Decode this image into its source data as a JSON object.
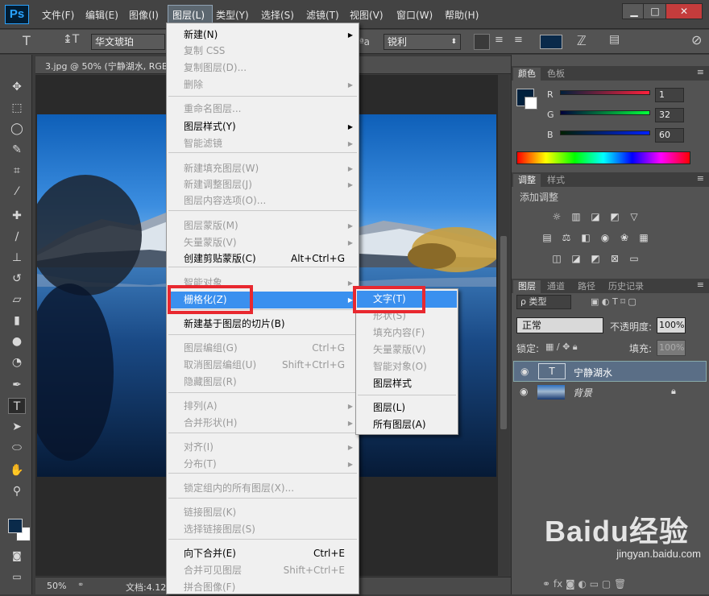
{
  "app": {
    "logo": "Ps"
  },
  "menubar": {
    "items": [
      "文件(F)",
      "编辑(E)",
      "图像(I)",
      "图层(L)",
      "类型(Y)",
      "选择(S)",
      "滤镜(T)",
      "视图(V)",
      "窗口(W)",
      "帮助(H)"
    ],
    "window_buttons": [
      "▁",
      "□",
      "✕"
    ]
  },
  "options": {
    "font_family": "华文琥珀",
    "aa_label": "ªa",
    "aa_value": "锐利",
    "color": "#0a2a4a"
  },
  "document": {
    "tab_title": "3.jpg @ 50% (宁静湖水, RGB",
    "zoom": "50%",
    "doc_info": "文档:4.12"
  },
  "layer_menu": {
    "items": [
      {
        "label": "新建(N)",
        "disabled": false,
        "submenu": true
      },
      {
        "label": "复制 CSS",
        "disabled": true
      },
      {
        "label": "复制图层(D)...",
        "disabled": true
      },
      {
        "label": "删除",
        "disabled": true,
        "submenu": true
      },
      {
        "label": "重命名图层...",
        "disabled": true
      },
      {
        "label": "图层样式(Y)",
        "disabled": false,
        "submenu": true
      },
      {
        "label": "智能滤镜",
        "disabled": true,
        "submenu": true
      },
      {
        "label": "新建填充图层(W)",
        "disabled": true,
        "submenu": true
      },
      {
        "label": "新建调整图层(J)",
        "disabled": true,
        "submenu": true
      },
      {
        "label": "图层内容选项(O)...",
        "disabled": true
      },
      {
        "label": "图层蒙版(M)",
        "disabled": true,
        "submenu": true
      },
      {
        "label": "矢量蒙版(V)",
        "disabled": true,
        "submenu": true
      },
      {
        "label": "创建剪贴蒙版(C)",
        "disabled": false,
        "shortcut": "Alt+Ctrl+G"
      },
      {
        "label": "智能对象",
        "disabled": true,
        "submenu": true
      },
      {
        "label": "栅格化(Z)",
        "disabled": false,
        "submenu": true,
        "highlighted": true
      },
      {
        "label": "新建基于图层的切片(B)",
        "disabled": false
      },
      {
        "label": "图层编组(G)",
        "disabled": true,
        "shortcut": "Ctrl+G"
      },
      {
        "label": "取消图层编组(U)",
        "disabled": true,
        "shortcut": "Shift+Ctrl+G"
      },
      {
        "label": "隐藏图层(R)",
        "disabled": true
      },
      {
        "label": "排列(A)",
        "disabled": true,
        "submenu": true
      },
      {
        "label": "合并形状(H)",
        "disabled": true,
        "submenu": true
      },
      {
        "label": "对齐(I)",
        "disabled": true,
        "submenu": true
      },
      {
        "label": "分布(T)",
        "disabled": true,
        "submenu": true
      },
      {
        "label": "锁定组内的所有图层(X)...",
        "disabled": true
      },
      {
        "label": "链接图层(K)",
        "disabled": true
      },
      {
        "label": "选择链接图层(S)",
        "disabled": true
      },
      {
        "label": "向下合并(E)",
        "disabled": false,
        "shortcut": "Ctrl+E"
      },
      {
        "label": "合并可见图层",
        "disabled": true,
        "shortcut": "Shift+Ctrl+E"
      },
      {
        "label": "拼合图像(F)",
        "disabled": true
      }
    ]
  },
  "rasterize_menu": {
    "items": [
      {
        "label": "文字(T)",
        "disabled": false,
        "highlighted": true
      },
      {
        "label": "形状(S)",
        "disabled": true
      },
      {
        "label": "填充内容(F)",
        "disabled": true
      },
      {
        "label": "矢量蒙版(V)",
        "disabled": true
      },
      {
        "label": "智能对象(O)",
        "disabled": true
      },
      {
        "label": "图层样式",
        "disabled": false
      },
      {
        "label": "图层(L)",
        "disabled": false
      },
      {
        "label": "所有图层(A)",
        "disabled": false
      }
    ]
  },
  "color_panel": {
    "tabs": [
      "颜色",
      "色板"
    ],
    "r_label": "R",
    "r": "1",
    "g_label": "G",
    "g": "32",
    "b_label": "B",
    "b": "60",
    "swatch": "#01203c"
  },
  "adjust_panel": {
    "tabs": [
      "调整",
      "样式"
    ],
    "title": "添加调整"
  },
  "layers_panel": {
    "tabs": [
      "图层",
      "通道",
      "路径",
      "历史记录"
    ],
    "filter_label": "ρ 类型",
    "blend_mode": "正常",
    "opacity_label": "不透明度:",
    "opacity": "100%",
    "lock_label": "锁定:",
    "fill_label": "填充:",
    "fill": "100%",
    "layers": [
      {
        "name": "宁静湖水",
        "type": "text",
        "selected": true
      },
      {
        "name": "背景",
        "type": "image",
        "selected": false
      }
    ]
  },
  "watermark": {
    "text": "Baidu经验",
    "sub": "jingyan.baidu.com"
  }
}
